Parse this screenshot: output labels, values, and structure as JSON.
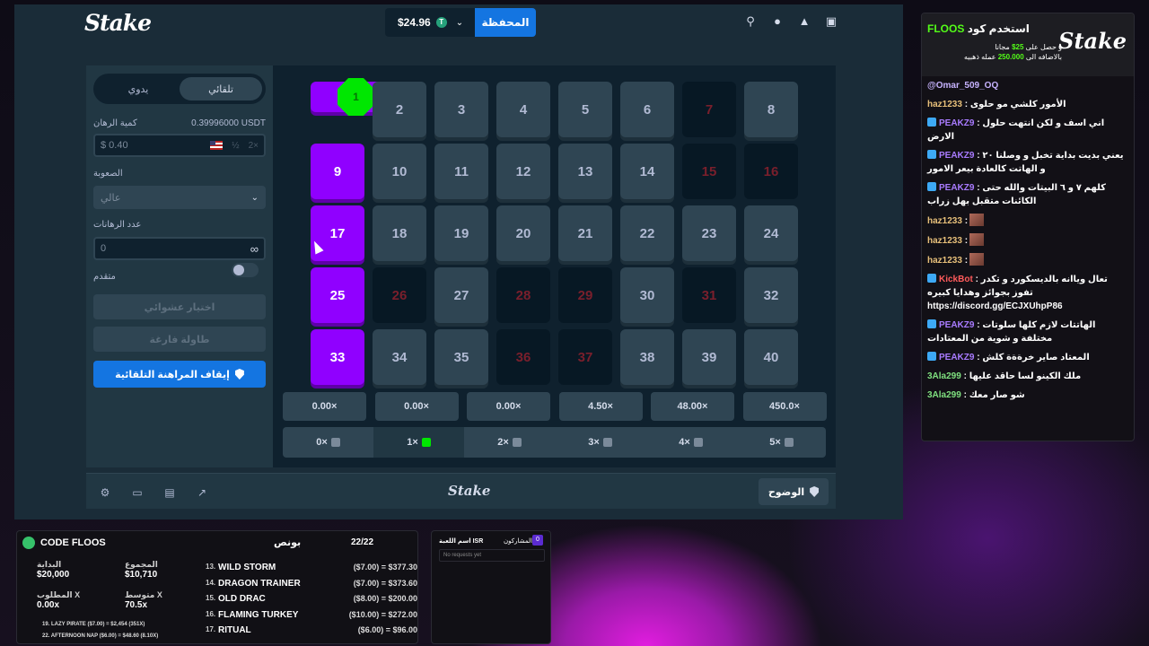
{
  "topbar": {
    "logo": "Stake",
    "balance": "$24.96",
    "currency_symbol": "T",
    "wallet_label": "المحفظة",
    "icons": [
      "search-icon",
      "user-icon",
      "bell-icon",
      "sidebar-toggle-icon"
    ]
  },
  "sidebar": {
    "tab_auto": "تلقائي",
    "tab_manual": "يدوي",
    "bet_amount_label": "كمية الرهان",
    "bet_amount_crypto": "0.39996000 USDT",
    "bet_amount_value": "$ 0.40",
    "half_label": "½",
    "double_label": "2×",
    "difficulty_label": "الصعوبة",
    "difficulty_value": "عالي",
    "num_bets_label": "عدد الرهانات",
    "num_bets_value": "0",
    "infinity": "∞",
    "advanced_label": "متقدم",
    "random_pick_label": "اختيار عشوائي",
    "clear_table_label": "طاولة فارغة",
    "stop_autobet_label": "إيقاف المراهنة التلقائية"
  },
  "board": {
    "tiles": [
      "1",
      "2",
      "3",
      "4",
      "5",
      "6",
      "7",
      "8",
      "9",
      "10",
      "11",
      "12",
      "13",
      "14",
      "15",
      "16",
      "17",
      "18",
      "19",
      "20",
      "21",
      "22",
      "23",
      "24",
      "25",
      "26",
      "27",
      "28",
      "29",
      "30",
      "31",
      "32",
      "33",
      "34",
      "35",
      "36",
      "37",
      "38",
      "39",
      "40"
    ],
    "multipliers": [
      "0.00×",
      "0.00×",
      "0.00×",
      "4.50×",
      "48.00×",
      "450.0×"
    ],
    "hits": [
      "0×",
      "1×",
      "2×",
      "3×",
      "4×",
      "5×"
    ]
  },
  "footer": {
    "logo": "Stake",
    "fairness_label": "الوضوح"
  },
  "chat": {
    "promo_line1": "استخدم كود",
    "promo_code": "FLOOS",
    "promo_line2a": "و حصل على",
    "promo_amount1": "25$",
    "promo_line2b": "مجانا",
    "promo_line3a": "بالاضافه الى",
    "promo_amount2": "250.000",
    "promo_line3b": "عمله ذهبيه",
    "promo_logo": "Stake",
    "messages": [
      {
        "user": "@Omar_509_OQ",
        "text": ""
      },
      {
        "user": "haz1233",
        "text": ": الأمور كلشي مو حلوى"
      },
      {
        "user": "PEAKZ9",
        "text": ": اني اسف و لكن انتهت حلول الارض"
      },
      {
        "user": "PEAKZ9",
        "text": ": يعني بديت بداية تخبل و وصلنا ٢٠ و الهاتت كالعادة بيعر الامور"
      },
      {
        "user": "PEAKZ9",
        "text": ": كلهم ٧ و ٦ البيتات والله حتى الكائنات متقبل بهل زراب"
      },
      {
        "user": "haz1233",
        "text": ":"
      },
      {
        "user": "haz1233",
        "text": ":"
      },
      {
        "user": "haz1233",
        "text": ":"
      },
      {
        "user": "KickBot",
        "text": ": تعال وياانه بالديسكورد و تكدر تفوز بجوائز وهدايا كبيره https://discord.gg/ECJXUhpP86"
      },
      {
        "user": "PEAKZ9",
        "text": ": الهاتتات لازم كلها سلوتات مختلفة و شوية من المعتادات"
      },
      {
        "user": "PEAKZ9",
        "text": ": المعتاد صاير خرةةة كلش"
      },
      {
        "user": "3Ala299",
        "text": ": ملك الكينو لسا حاقد عليها"
      },
      {
        "user": "3Ala299",
        "text": ": شو صار معك"
      }
    ]
  },
  "bonus_hunt": {
    "title": "CODE FLOOS",
    "bonus_label": "بونص",
    "count": "22/22",
    "start_label": "البداية",
    "start_value": "$20,000",
    "total_label": "المجموع",
    "total_value": "$10,710",
    "required_label": "المطلوب X",
    "required_value": "0.00x",
    "average_label": "متوسط X",
    "average_value": "70.5x",
    "best_line": "19. LAZY PIRATE ($7.00) = $2,454 (351X)",
    "worst_line": "22. AFTERNOON NAP ($6.00) = $48.60 (8.10X)",
    "rows": [
      {
        "n": "13.",
        "name": "WILD STORM",
        "value": "($7.00) = $377.30"
      },
      {
        "n": "14.",
        "name": "DRAGON TRAINER",
        "value": "($7.00) = $373.60"
      },
      {
        "n": "15.",
        "name": "OLD DRAC",
        "value": "($8.00) = $200.00"
      },
      {
        "n": "16.",
        "name": "FLAMING TURKEY",
        "value": "($10.00) = $272.00"
      },
      {
        "n": "17.",
        "name": "RITUAL",
        "value": "($6.00) = $96.00"
      }
    ]
  },
  "requests": {
    "game_name_label": "اسم اللعبة ISR",
    "participants_label": "المشاركون",
    "count": "0",
    "empty_text": "No requests yet"
  }
}
